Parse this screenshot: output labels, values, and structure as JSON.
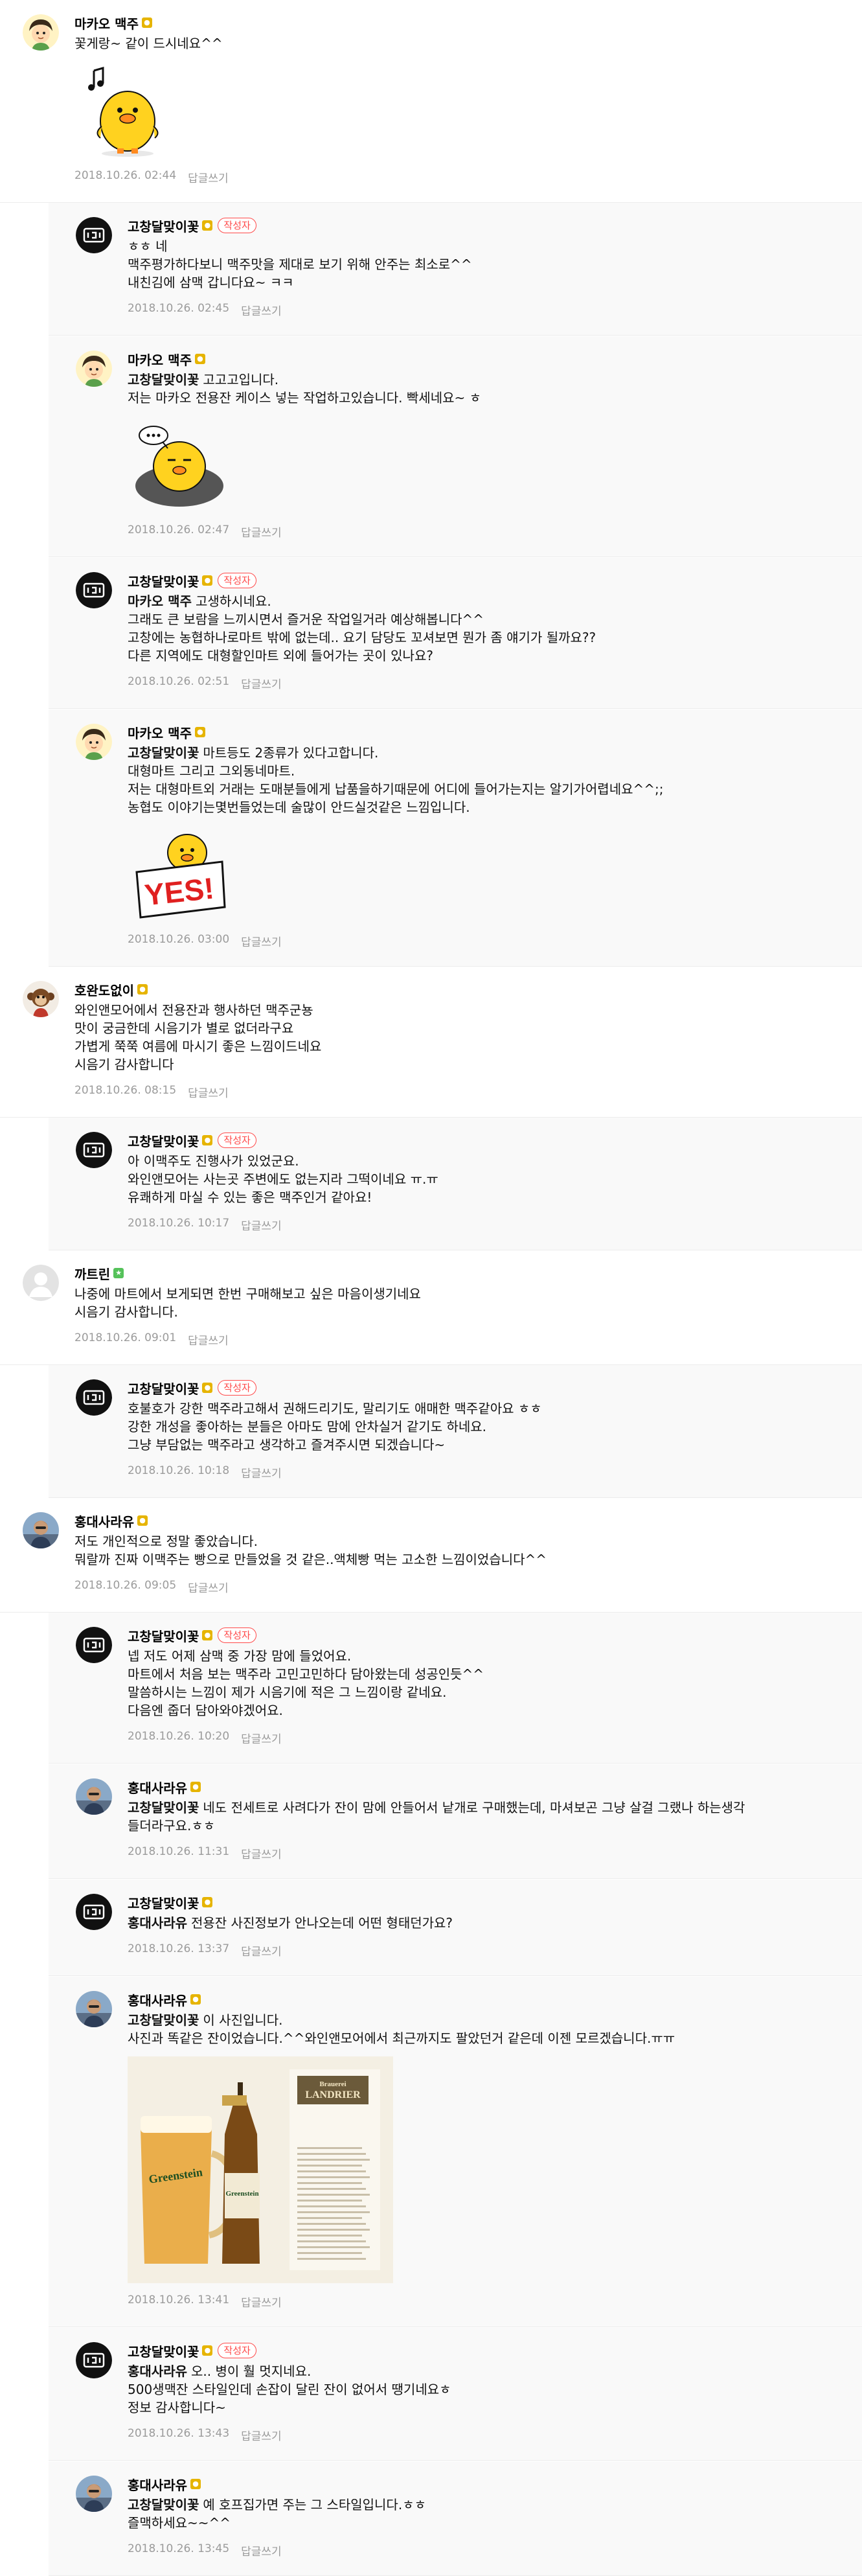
{
  "reply_label": "답글쓰기",
  "author_badge": "작성자",
  "comments": [
    {
      "type": "comment",
      "avatar": "avatar-cartoon-boy",
      "nick": "마카오 맥주",
      "grade": "gold",
      "author": false,
      "mention": "",
      "lines": [
        "꽃게랑~ 같이 드시네요^^"
      ],
      "sticker": "duck-music",
      "date": "2018.10.26. 02:44"
    },
    {
      "type": "reply",
      "avatar": "avatar-logo",
      "nick": "고창달맞이꽃",
      "grade": "gold",
      "author": true,
      "mention": "",
      "lines": [
        "ㅎㅎ 네",
        "맥주평가하다보니 맥주맛을 제대로 보기 위해 안주는 최소로^^",
        "내친김에 삼맥 갑니다요~ ㅋㅋ"
      ],
      "date": "2018.10.26. 02:45"
    },
    {
      "type": "reply",
      "avatar": "avatar-cartoon-boy",
      "nick": "마카오 맥주",
      "grade": "gold",
      "author": false,
      "mention": "고창달맞이꽃",
      "lines": [
        "고고고입니다.",
        "저는 마카오 전용잔 케이스 넣는 작업하고있습니다. 빡세네요~ ㅎ"
      ],
      "sticker": "duck-tired",
      "date": "2018.10.26. 02:47"
    },
    {
      "type": "reply",
      "avatar": "avatar-logo",
      "nick": "고창달맞이꽃",
      "grade": "gold",
      "author": true,
      "mention": "마카오 맥주",
      "lines": [
        "고생하시네요.",
        "그래도 큰 보람을 느끼시면서 즐거운 작업일거라 예상해봅니다^^",
        "고창에는 농협하나로마트 밖에 없는데.. 요기 담당도 꼬셔보면 뭔가 좀 얘기가 될까요??",
        "다른 지역에도 대형할인마트 외에 들어가는 곳이 있나요?"
      ],
      "date": "2018.10.26. 02:51"
    },
    {
      "type": "reply",
      "avatar": "avatar-cartoon-boy",
      "nick": "마카오 맥주",
      "grade": "gold",
      "author": false,
      "mention": "고창달맞이꽃",
      "lines": [
        "마트등도 2종류가 있다고합니다.",
        "대형마트 그리고 그외동네마트.",
        "저는 대형마트외 거래는 도매분들에게 납품을하기때문에 어디에 들어가는지는 알기가어렵네요^^;;",
        "농협도 이야기는몇번들었는데 술많이 안드실것같은 느낌입니다."
      ],
      "sticker": "duck-yes",
      "date": "2018.10.26. 03:00"
    },
    {
      "type": "comment",
      "avatar": "avatar-monkey",
      "nick": "호완도없이",
      "grade": "gold",
      "author": false,
      "mention": "",
      "lines": [
        "와인앤모어에서 전용잔과 행사하던 맥주군뇽",
        "맛이 궁금한데 시음기가 별로 없더라구요",
        "가볍게 쭉쭉 여름에 마시기 좋은 느낌이드네요",
        "시음기 감사합니다"
      ],
      "date": "2018.10.26. 08:15"
    },
    {
      "type": "reply",
      "avatar": "avatar-logo",
      "nick": "고창달맞이꽃",
      "grade": "gold",
      "author": true,
      "mention": "",
      "lines": [
        "아 이맥주도 진행사가 있었군요.",
        "와인앤모어는 사는곳 주변에도 없는지라 그떡이네요 ㅠ.ㅠ",
        "유쾌하게 마실 수 있는 좋은 맥주인거 같아요!"
      ],
      "date": "2018.10.26. 10:17"
    },
    {
      "type": "comment",
      "avatar": "avatar-default",
      "nick": "까트린",
      "grade": "green",
      "author": false,
      "mention": "",
      "lines": [
        "나중에 마트에서 보게되면 한번 구매해보고 싶은 마음이생기네요",
        "시음기 감사합니다."
      ],
      "date": "2018.10.26. 09:01"
    },
    {
      "type": "reply",
      "avatar": "avatar-logo",
      "nick": "고창달맞이꽃",
      "grade": "gold",
      "author": true,
      "mention": "",
      "lines": [
        "호불호가 강한 맥주라고해서 권해드리기도, 말리기도 애매한 맥주같아요 ㅎㅎ",
        "강한 개성을 좋아하는 분들은 아마도 맘에 안차실거 같기도 하네요.",
        "그냥 부담없는 맥주라고 생각하고 즐겨주시면 되겠습니다~"
      ],
      "date": "2018.10.26. 10:18"
    },
    {
      "type": "comment",
      "avatar": "avatar-photo",
      "nick": "홍대사라유",
      "grade": "gold",
      "author": false,
      "mention": "",
      "lines": [
        "저도 개인적으로 정말 좋았습니다.",
        "뭐랄까 진짜 이맥주는 빵으로 만들었을 것 같은..액체빵 먹는 고소한 느낌이었습니다^^"
      ],
      "date": "2018.10.26. 09:05"
    },
    {
      "type": "reply",
      "avatar": "avatar-logo",
      "nick": "고창달맞이꽃",
      "grade": "gold",
      "author": true,
      "mention": "",
      "lines": [
        "넵 저도 어제 삼맥 중 가장 맘에 들었어요.",
        "마트에서 처음 보는 맥주라 고민고민하다 담아왔는데 성공인듯^^",
        "말씀하시는 느낌이 제가 시음기에 적은 그 느낌이랑 같네요.",
        "다음엔 줍더 담아와야겠어요."
      ],
      "date": "2018.10.26. 10:20"
    },
    {
      "type": "reply",
      "avatar": "avatar-photo",
      "nick": "홍대사라유",
      "grade": "gold",
      "author": false,
      "mention": "고창달맞이꽃",
      "lines": [
        "네도 전세트로 사려다가 잔이 맘에 안들어서 낱개로 구매했는데, 마셔보곤 그냥 살걸 그랬나 하는생각",
        "들더라구요.ㅎㅎ"
      ],
      "date": "2018.10.26. 11:31"
    },
    {
      "type": "reply",
      "avatar": "avatar-logo",
      "nick": "고창달맞이꽃",
      "grade": "gold",
      "author": false,
      "mention": "홍대사라유",
      "lines": [
        "전용잔 사진정보가 안나오는데 어떤 형태던가요?"
      ],
      "date": "2018.10.26. 13:37"
    },
    {
      "type": "reply",
      "avatar": "avatar-photo",
      "nick": "홍대사라유",
      "grade": "gold",
      "author": false,
      "mention": "고창달맞이꽃",
      "lines": [
        "이 사진입니다.",
        "사진과 똑같은 잔이었습니다.^^와인앤모어에서 최근까지도 팔았던거 같은데 이젠 모르겠습니다.ㅠㅠ"
      ],
      "photo": "beer-glass-photo",
      "photo_text": {
        "mug_label": "Greenstein",
        "bottle_label": "Greenstein",
        "brand_top": "Brauerei",
        "brand_name": "LANDRIER"
      },
      "date": "2018.10.26. 13:41"
    },
    {
      "type": "reply",
      "avatar": "avatar-logo",
      "nick": "고창달맞이꽃",
      "grade": "gold",
      "author": true,
      "mention": "홍대사라유",
      "lines": [
        "오.. 병이 훨 멋지네요.",
        "500생맥잔 스타일인데 손잡이 달린 잔이 없어서 땡기네요ㅎ",
        "정보 감사합니다~"
      ],
      "date": "2018.10.26. 13:43"
    },
    {
      "type": "reply",
      "avatar": "avatar-photo",
      "nick": "홍대사라유",
      "grade": "gold",
      "author": false,
      "mention": "고창달맞이꽃",
      "lines": [
        "예 호프집가면 주는 그 스타일입니다.ㅎㅎ",
        "즐맥하세요~~^^"
      ],
      "date": "2018.10.26. 13:45"
    }
  ]
}
